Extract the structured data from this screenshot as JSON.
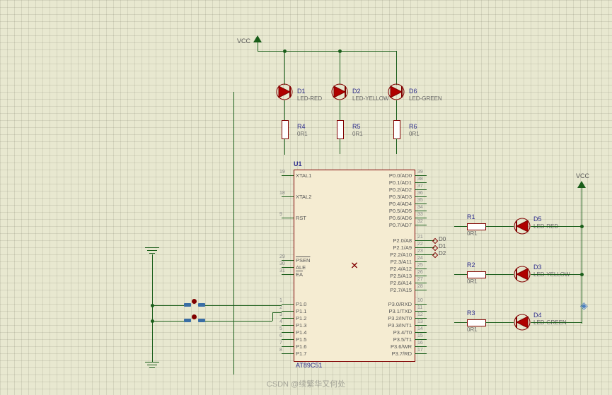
{
  "power": {
    "vcc_top": "VCC",
    "vcc_right": "VCC"
  },
  "leds": {
    "D1": {
      "ref": "D1",
      "type": "LED-RED"
    },
    "D2": {
      "ref": "D2",
      "type": "LED-YELLOW"
    },
    "D6": {
      "ref": "D6",
      "type": "LED-GREEN"
    },
    "D5": {
      "ref": "D5",
      "type": "LED-RED"
    },
    "D3": {
      "ref": "D3",
      "type": "LED-YELLOW"
    },
    "D4": {
      "ref": "D4",
      "type": "LED-GREEN"
    }
  },
  "resistors": {
    "R4": {
      "ref": "R4",
      "val": "0R1"
    },
    "R5": {
      "ref": "R5",
      "val": "0R1"
    },
    "R6": {
      "ref": "R6",
      "val": "0R1"
    },
    "R1": {
      "ref": "R1",
      "val": "0R1"
    },
    "R2": {
      "ref": "R2",
      "val": "0R1"
    },
    "R3": {
      "ref": "R3",
      "val": "0R1"
    }
  },
  "chip": {
    "ref": "U1",
    "part": "AT89C51",
    "left_pins": [
      {
        "num": "19",
        "name": "XTAL1"
      },
      {
        "num": "18",
        "name": "XTAL2"
      },
      {
        "num": "9",
        "name": "RST"
      },
      {
        "num": "29",
        "name": "PSEN",
        "over": true
      },
      {
        "num": "30",
        "name": "ALE"
      },
      {
        "num": "31",
        "name": "EA",
        "over": true
      },
      {
        "num": "1",
        "name": "P1.0"
      },
      {
        "num": "2",
        "name": "P1.1"
      },
      {
        "num": "3",
        "name": "P1.2"
      },
      {
        "num": "4",
        "name": "P1.3"
      },
      {
        "num": "5",
        "name": "P1.4"
      },
      {
        "num": "6",
        "name": "P1.5"
      },
      {
        "num": "7",
        "name": "P1.6"
      },
      {
        "num": "8",
        "name": "P1.7"
      }
    ],
    "right_pins": [
      {
        "num": "39",
        "name": "P0.0/AD0"
      },
      {
        "num": "38",
        "name": "P0.1/AD1"
      },
      {
        "num": "37",
        "name": "P0.2/AD2"
      },
      {
        "num": "36",
        "name": "P0.3/AD3"
      },
      {
        "num": "35",
        "name": "P0.4/AD4"
      },
      {
        "num": "34",
        "name": "P0.5/AD5"
      },
      {
        "num": "33",
        "name": "P0.6/AD6"
      },
      {
        "num": "32",
        "name": "P0.7/AD7"
      },
      {
        "num": "21",
        "name": "P2.0/A8"
      },
      {
        "num": "22",
        "name": "P2.1/A9"
      },
      {
        "num": "23",
        "name": "P2.2/A10"
      },
      {
        "num": "24",
        "name": "P2.3/A11"
      },
      {
        "num": "25",
        "name": "P2.4/A12"
      },
      {
        "num": "26",
        "name": "P2.5/A13"
      },
      {
        "num": "27",
        "name": "P2.6/A14"
      },
      {
        "num": "28",
        "name": "P2.7/A15"
      },
      {
        "num": "10",
        "name": "P3.0/RXD"
      },
      {
        "num": "11",
        "name": "P3.1/TXD"
      },
      {
        "num": "12",
        "name": "P3.2/INT0"
      },
      {
        "num": "13",
        "name": "P3.3/INT1"
      },
      {
        "num": "14",
        "name": "P3.4/T0"
      },
      {
        "num": "15",
        "name": "P3.5/T1"
      },
      {
        "num": "16",
        "name": "P3.6/WR"
      },
      {
        "num": "17",
        "name": "P3.7/RD"
      }
    ],
    "port2_labels": [
      "D0",
      "D1",
      "D2"
    ]
  },
  "watermark": "CSDN @续繁华又何处"
}
